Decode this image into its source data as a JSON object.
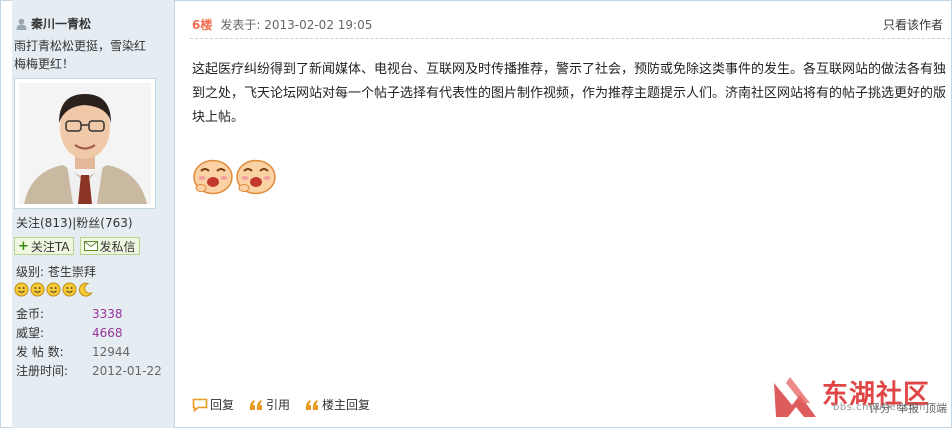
{
  "user": {
    "name": "秦川一青松",
    "signature": "雨打青松松更挺，雪染红梅梅更红！",
    "follow_text": "关注(813)|粉丝(763)",
    "follow_button": "关注TA",
    "message_button": "发私信",
    "level_label": "级别:",
    "level_value": "苍生崇拜",
    "stats": [
      {
        "label": "金币:",
        "value": "3338"
      },
      {
        "label": "威望:",
        "value": "4668"
      },
      {
        "label": "发 帖 数:",
        "value": "12944"
      },
      {
        "label": "注册时间:",
        "value": "2012-01-22"
      }
    ]
  },
  "post": {
    "floor": "6楼",
    "posted_at": "发表于: 2013-02-02 19:05",
    "only_author": "只看该作者",
    "body": "这起医疗纠纷得到了新闻媒体、电视台、互联网及时传播推荐，警示了社会，预防或免除这类事件的发生。各互联网站的做法各有独到之处，飞天论坛网站对每一个帖子选择有代表性的图片制作视频，作为推荐主题提示人们。济南社区网站将有的帖子挑选更好的版块上帖。"
  },
  "actions": {
    "reply": "回复",
    "quote": "引用",
    "host_reply": "楼主回复"
  },
  "footer": {
    "logo_text": "东湖社区",
    "logo_url": "bbs.cnhubei.com",
    "rate": "评分",
    "report": "举报",
    "top": "顶端"
  },
  "colors": {
    "floor": "#f26c4f",
    "sidebar_bg": "#e5edf2",
    "border": "#c2d5e3",
    "logo_red": "#dd3333"
  }
}
